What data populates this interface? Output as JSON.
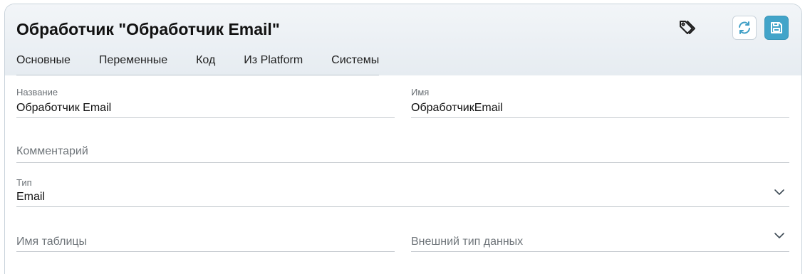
{
  "header": {
    "title": "Обработчик \"Обработчик Email\""
  },
  "toolbar": {
    "tag_icon": "tag-icon",
    "refresh_icon": "refresh-icon",
    "save_icon": "save-icon",
    "save_color": "#42a4c9"
  },
  "tabs": [
    {
      "label": "Основные"
    },
    {
      "label": "Переменные"
    },
    {
      "label": "Код"
    },
    {
      "label": "Из Platform"
    },
    {
      "label": "Системы"
    }
  ],
  "form": {
    "name": {
      "label": "Название",
      "value": "Обработчик Email"
    },
    "system_name": {
      "label": "Имя",
      "value": "ОбработчикEmail"
    },
    "comment": {
      "placeholder": "Комментарий"
    },
    "type": {
      "label": "Тип",
      "value": "Email"
    },
    "table_name": {
      "placeholder": "Имя таблицы"
    },
    "external_type": {
      "placeholder": "Внешний тип данных"
    }
  }
}
